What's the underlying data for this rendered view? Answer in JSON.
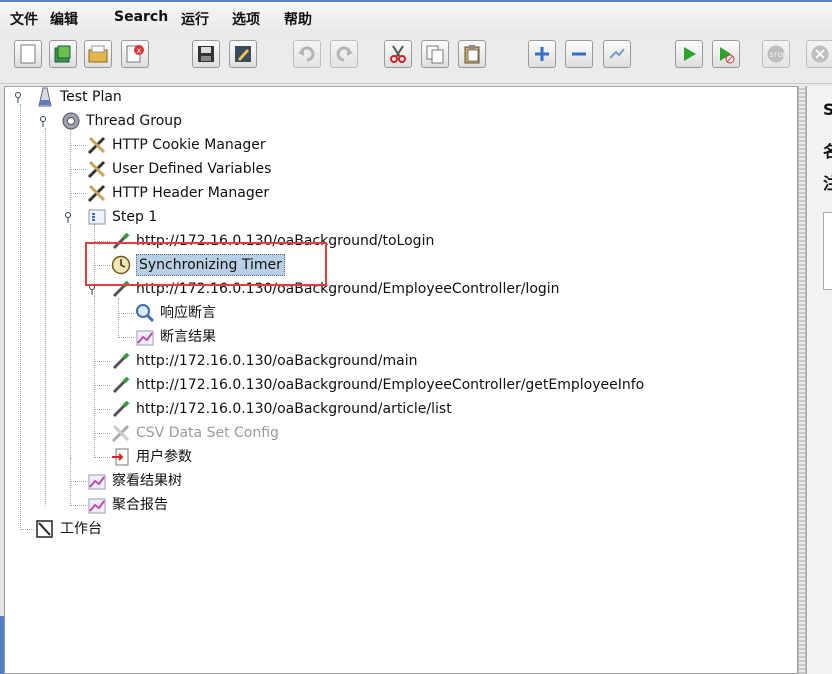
{
  "menu": [
    "文件",
    "编辑",
    "Search",
    "运行",
    "选项",
    "帮助"
  ],
  "toolbar": {
    "buttons": [
      "new-icon",
      "templates-icon",
      "open-icon",
      "close-icon",
      "save-icon",
      "edit-icon",
      "undo-icon",
      "redo-icon",
      "cut-icon",
      "copy-icon",
      "paste-icon",
      "expand-icon",
      "collapse-icon",
      "toggle-icon",
      "start-icon",
      "start-no-pause-icon",
      "stop-icon",
      "shutdown-icon"
    ]
  },
  "tree": {
    "test_plan": "Test Plan",
    "thread_group": "Thread Group",
    "cookie_manager": "HTTP Cookie Manager",
    "user_defined_vars": "User Defined Variables",
    "header_manager": "HTTP Header Manager",
    "step1": "Step 1",
    "req_tologin": "http://172.16.0.130/oaBackground/toLogin",
    "sync_timer": "Synchronizing Timer",
    "req_login": "http://172.16.0.130/oaBackground/EmployeeController/login",
    "resp_assert": "响应断言",
    "assert_result": "断言结果",
    "req_main": "http://172.16.0.130/oaBackground/main",
    "req_getinfo": "http://172.16.0.130/oaBackground/EmployeeController/getEmployeeInfo",
    "req_article": "http://172.16.0.130/oaBackground/article/list",
    "csv_config": "CSV Data Set Config",
    "user_params": "用户参数",
    "view_results": "察看结果树",
    "aggregate": "聚合报告",
    "workbench": "工作台"
  },
  "right_panel": {
    "t1": "S",
    "t2": "名",
    "t3": "注"
  },
  "colors": {
    "selection": "#b8cfe5",
    "highlight_border": "#e2403f"
  }
}
